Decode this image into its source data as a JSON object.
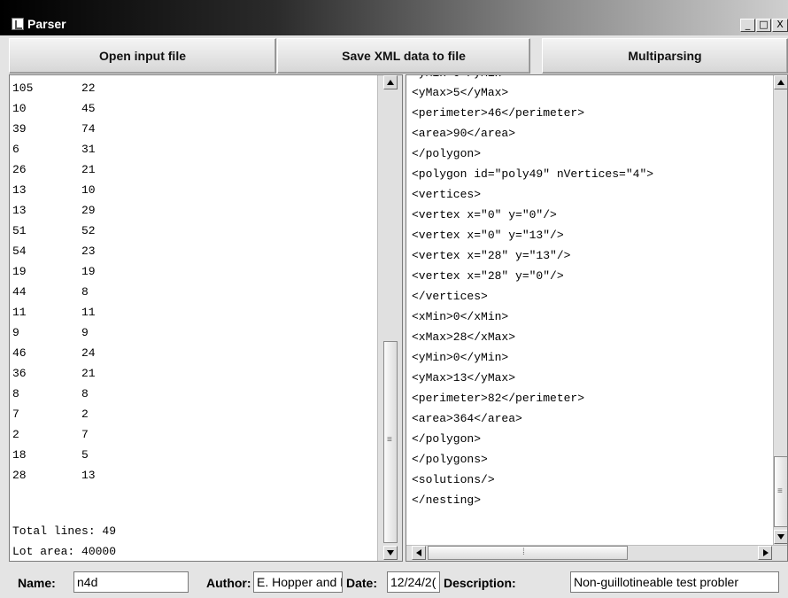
{
  "window": {
    "title": "Parser",
    "controls": [
      "_",
      "□",
      "X"
    ]
  },
  "toolbar": {
    "open_label": "Open input file",
    "save_label": "Save XML data to file",
    "multi_label": "Multiparsing"
  },
  "left_panel": {
    "rows": [
      [
        "105",
        "22"
      ],
      [
        "10",
        "45"
      ],
      [
        "39",
        "74"
      ],
      [
        "6",
        "31"
      ],
      [
        "26",
        "21"
      ],
      [
        "13",
        "10"
      ],
      [
        "13",
        "29"
      ],
      [
        "51",
        "52"
      ],
      [
        "54",
        "23"
      ],
      [
        "19",
        "19"
      ],
      [
        "44",
        "8"
      ],
      [
        "11",
        "11"
      ],
      [
        "9",
        "9"
      ],
      [
        "46",
        "24"
      ],
      [
        "36",
        "21"
      ],
      [
        "8",
        "8"
      ],
      [
        "7",
        "2"
      ],
      [
        "2",
        "7"
      ],
      [
        "18",
        "5"
      ],
      [
        "28",
        "13"
      ]
    ],
    "total_lines": "Total lines: 49",
    "lot_area": "Lot area: 40000"
  },
  "right_panel": {
    "lines": [
      "<yMax>5</yMax>",
      "<perimeter>46</perimeter>",
      "<area>90</area>",
      "</polygon>",
      "<polygon id=\"poly49\" nVertices=\"4\">",
      "<vertices>",
      "<vertex x=\"0\" y=\"0\"/>",
      "<vertex x=\"0\" y=\"13\"/>",
      "<vertex x=\"28\" y=\"13\"/>",
      "<vertex x=\"28\" y=\"0\"/>",
      "</vertices>",
      "<xMin>0</xMin>",
      "<xMax>28</xMax>",
      "<yMin>0</yMin>",
      "<yMax>13</yMax>",
      "<perimeter>82</perimeter>",
      "<area>364</area>",
      "</polygon>",
      "</polygons>",
      "<solutions/>",
      "</nesting>"
    ]
  },
  "footer": {
    "name_label": "Name:",
    "name_value": "n4d",
    "author_label": "Author:",
    "author_value": "E. Hopper and E",
    "date_label": "Date:",
    "date_value": "12/24/2(",
    "description_label": "Description:",
    "description_value": "Non-guillotineable test probler"
  }
}
